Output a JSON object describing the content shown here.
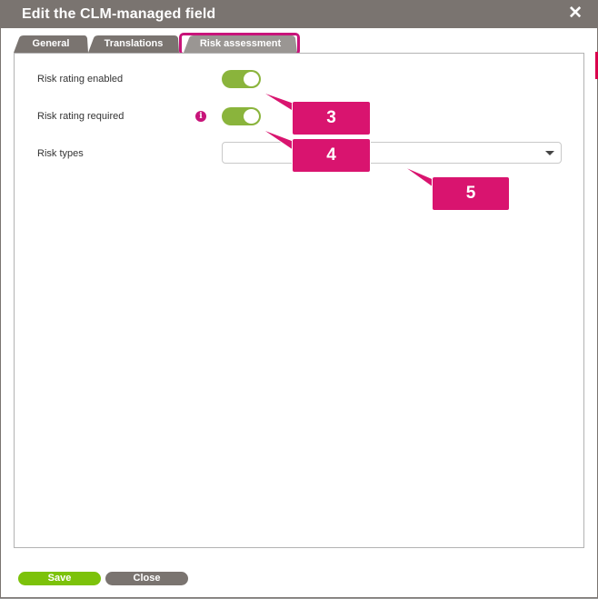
{
  "dialog": {
    "title": "Edit the CLM-managed field",
    "close_glyph": "✕"
  },
  "tabs": [
    {
      "label": "General",
      "active": false
    },
    {
      "label": "Translations",
      "active": false
    },
    {
      "label": "Risk assessment",
      "active": true
    }
  ],
  "fields": {
    "risk_rating_enabled": {
      "label": "Risk rating enabled",
      "value": true
    },
    "risk_rating_required": {
      "label": "Risk rating required",
      "value": true,
      "info_glyph": "i"
    },
    "risk_types": {
      "label": "Risk types",
      "value": ""
    }
  },
  "callouts": [
    "3",
    "4",
    "5"
  ],
  "footer": {
    "save_label": "Save",
    "close_label": "Close"
  },
  "colors": {
    "header": "#7a7470",
    "accent": "#c8147a",
    "callout": "#d9146f",
    "toggle_on": "#8ab43c",
    "save": "#7cc20a"
  }
}
